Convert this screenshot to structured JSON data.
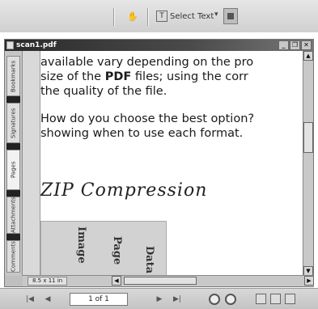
{
  "toolbar": {
    "select_text_label": "Select Text",
    "select_text_ibeam": "T",
    "dropdown_icon": "▾",
    "icons": {
      "hand": "hand-icon",
      "ibeam": "ibeam-icon",
      "dropdown": "chevron-down-icon",
      "snapshot": "snapshot-icon"
    }
  },
  "window": {
    "title": "scan1.pdf",
    "controls": {
      "minimize": "_",
      "restore": "❐",
      "close": "✕"
    }
  },
  "nav_tabs": [
    "Bookmarks",
    "Signatures",
    "Pages",
    "Attachments",
    "Comments"
  ],
  "page": {
    "lines": [
      {
        "text": "available vary depending on the pro"
      },
      {
        "pre": "size of the ",
        "bold": "PDF",
        "post": " files; using the corr"
      },
      {
        "text": "the quality of the file."
      },
      {
        "text": "How do you choose the best option?"
      },
      {
        "text": "showing when to use each format."
      }
    ],
    "handwriting": "ZIP Compression",
    "scan_words": [
      "Image",
      "Page",
      "Data"
    ]
  },
  "scrollbar": {
    "up": "▲",
    "down": "▼",
    "left": "◀",
    "right": "▶"
  },
  "page_size": "8.5 x 11 in",
  "status": {
    "page_indicator": "1 of 1",
    "first": "|◀",
    "prev": "◀",
    "next": "▶",
    "last": "▶|"
  }
}
